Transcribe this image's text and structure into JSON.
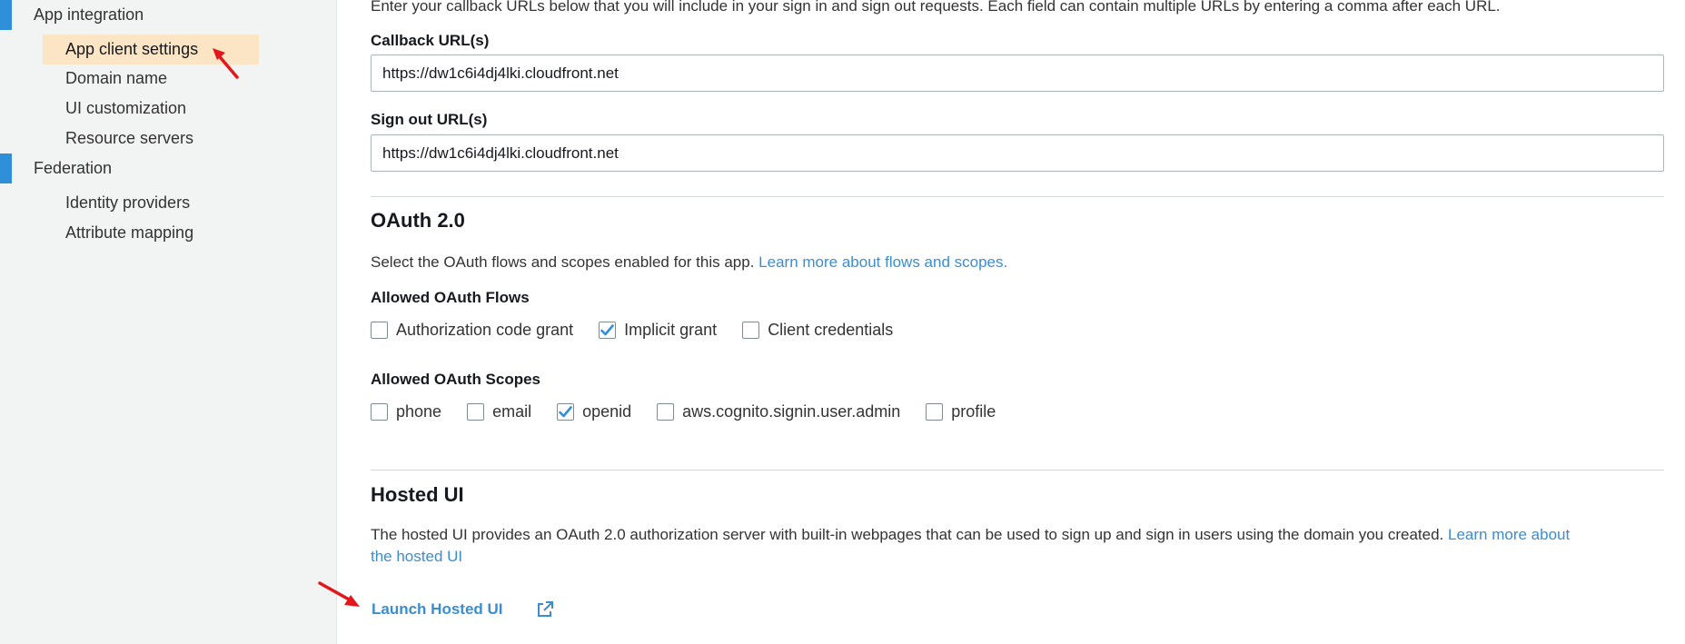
{
  "sidebar": {
    "sections": [
      {
        "label": "App integration",
        "items": [
          "App client settings",
          "Domain name",
          "UI customization",
          "Resource servers"
        ]
      },
      {
        "label": "Federation",
        "items": [
          "Identity providers",
          "Attribute mapping"
        ]
      }
    ],
    "active_item": "App client settings",
    "accent_color": "#2f8fd8",
    "active_bg": "#fbe5c4"
  },
  "callbacks": {
    "intro": "Enter your callback URLs below that you will include in your sign in and sign out requests. Each field can contain multiple URLs by entering a comma after each URL.",
    "callback_label": "Callback URL(s)",
    "callback_value": "https://dw1c6i4dj4lki.cloudfront.net",
    "signout_label": "Sign out URL(s)",
    "signout_value": "https://dw1c6i4dj4lki.cloudfront.net"
  },
  "oauth": {
    "title": "OAuth 2.0",
    "description": "Select the OAuth flows and scopes enabled for this app.",
    "learn_more": "Learn more about flows and scopes.",
    "flows_label": "Allowed OAuth Flows",
    "flows": [
      {
        "label": "Authorization code grant",
        "checked": false
      },
      {
        "label": "Implicit grant",
        "checked": true
      },
      {
        "label": "Client credentials",
        "checked": false
      }
    ],
    "scopes_label": "Allowed OAuth Scopes",
    "scopes": [
      {
        "label": "phone",
        "checked": false
      },
      {
        "label": "email",
        "checked": false
      },
      {
        "label": "openid",
        "checked": true
      },
      {
        "label": "aws.cognito.signin.user.admin",
        "checked": false
      },
      {
        "label": "profile",
        "checked": false
      }
    ]
  },
  "hosted_ui": {
    "title": "Hosted UI",
    "description": "The hosted UI provides an OAuth 2.0 authorization server with built-in webpages that can be used to sign up and sign in users using the domain you created.",
    "learn_more_line1": "Learn more about",
    "learn_more_line2": "the hosted UI",
    "launch_label": "Launch Hosted UI",
    "launch_icon": "external-link-icon"
  },
  "colors": {
    "link": "#3a8ed0",
    "annotation_arrow": "#e3161c",
    "checkmark": "#2f8fd8"
  }
}
